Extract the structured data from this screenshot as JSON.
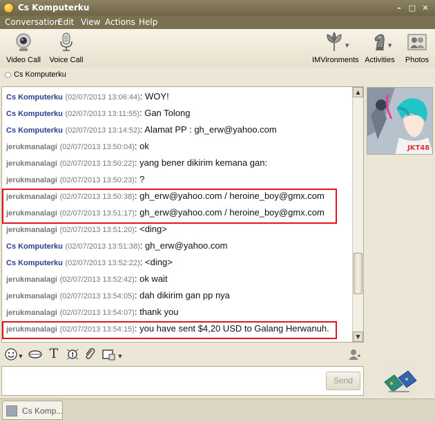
{
  "window": {
    "title": "Cs Komputerku",
    "controls": [
      "minimize",
      "maximize",
      "close"
    ]
  },
  "menu": [
    "Conversation",
    "Edit",
    "View",
    "Actions",
    "Help"
  ],
  "toolbar": {
    "left": [
      {
        "label": "Video Call",
        "icon": "webcam-icon"
      },
      {
        "label": "Voice Call",
        "icon": "microphone-icon"
      }
    ],
    "right": [
      {
        "label": "IMVironments",
        "icon": "leaf-icon"
      },
      {
        "label": "Activities",
        "icon": "chess-knight-icon"
      },
      {
        "label": "Photos",
        "icon": "photos-icon"
      }
    ]
  },
  "contact": {
    "name": "Cs Komputerku"
  },
  "messages": [
    {
      "sender": "Cs Komputerku",
      "time": "(02/07/2013 13:06:44)",
      "text": ": WOY!",
      "kind": "cs"
    },
    {
      "sender": "Cs Komputerku",
      "time": "(02/07/2013 13:11:55)",
      "text": ": Gan Tolong",
      "kind": "cs"
    },
    {
      "sender": "Cs Komputerku",
      "time": "(02/07/2013 13:14:52)",
      "text": ": Alamat PP : gh_erw@yahoo.com",
      "kind": "cs"
    },
    {
      "sender": "jerukmanalagi",
      "time": "(02/07/2013 13:50:04)",
      "text": ": ok",
      "kind": "jm"
    },
    {
      "sender": "jerukmanalagi",
      "time": "(02/07/2013 13:50:22)",
      "text": ": yang bener dikirim kemana gan:",
      "kind": "jm"
    },
    {
      "sender": "jerukmanalagi",
      "time": "(02/07/2013 13:50:23)",
      "text": ": ?",
      "kind": "jm"
    },
    {
      "sender": "jerukmanalagi",
      "time": "(02/07/2013 13:50:38)",
      "text": ": gh_erw@yahoo.com / heroine_boy@gmx.com",
      "kind": "jm"
    },
    {
      "sender": "jerukmanalagi",
      "time": "(02/07/2013 13:51:17)",
      "text": ": gh_erw@yahoo.com / heroine_boy@gmx.com",
      "kind": "jm"
    },
    {
      "sender": "jerukmanalagi",
      "time": "(02/07/2013 13:51:20)",
      "text": ": <ding>",
      "kind": "jm"
    },
    {
      "sender": "Cs Komputerku",
      "time": "(02/07/2013 13:51:38)",
      "text": ": gh_erw@yahoo.com",
      "kind": "cs"
    },
    {
      "sender": "Cs Komputerku",
      "time": "(02/07/2013 13:52:22)",
      "text": ": <ding>",
      "kind": "cs"
    },
    {
      "sender": "jerukmanalagi",
      "time": "(02/07/2013 13:52:42)",
      "text": ": ok wait",
      "kind": "jm"
    },
    {
      "sender": "jerukmanalagi",
      "time": "(02/07/2013 13:54:05)",
      "text": ": dah dikirim gan pp nya",
      "kind": "jm"
    },
    {
      "sender": "jerukmanalagi",
      "time": "(02/07/2013 13:54:07)",
      "text": ": thank you",
      "kind": "jm"
    },
    {
      "sender": "jerukmanalagi",
      "time": "(02/07/2013 13:54:15)",
      "text": ": you have sent $4,20 USD to Galang Herwanuh.",
      "kind": "jm"
    }
  ],
  "colors": {
    "cs_sender": "#2b3e8e",
    "jm_sender": "#777777",
    "highlight": "#e0141c",
    "titlebar": "#7b7150"
  },
  "format_toolbar": [
    "emoticon-icon",
    "lips-icon",
    "text-format-icon",
    "buzz-icon",
    "attach-icon",
    "insert-icon",
    "contact-icon"
  ],
  "composer": {
    "value": "",
    "send_label": "Send"
  },
  "tabs": [
    {
      "label": "Cs Komp..."
    }
  ]
}
